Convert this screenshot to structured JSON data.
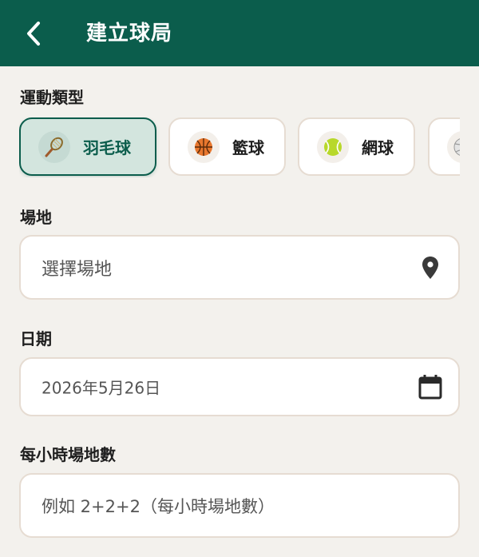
{
  "header": {
    "title": "建立球局",
    "background_color": "#0b5d4c",
    "back_icon": "chevron-left-icon"
  },
  "sport_type": {
    "label": "運動類型",
    "options": [
      {
        "label": "羽毛球",
        "icon": "badminton-racket-icon",
        "selected": true
      },
      {
        "label": "籃球",
        "icon": "basketball-icon",
        "selected": false
      },
      {
        "label": "網球",
        "icon": "tennis-ball-icon",
        "selected": false
      },
      {
        "label": "",
        "icon": "volleyball-icon",
        "selected": false
      }
    ]
  },
  "venue": {
    "label": "場地",
    "placeholder": "選擇場地",
    "icon": "location-pin-icon"
  },
  "date": {
    "label": "日期",
    "value": "2026年5月26日",
    "icon": "calendar-icon"
  },
  "courts_per_hour": {
    "label": "每小時場地數",
    "placeholder": "例如 2+2+2（每小時場地數）"
  },
  "colors": {
    "accent": "#0b5d4c",
    "selected_chip_bg": "#d3e5de",
    "page_bg": "#f3f1ed",
    "border": "#e6dcd2"
  }
}
